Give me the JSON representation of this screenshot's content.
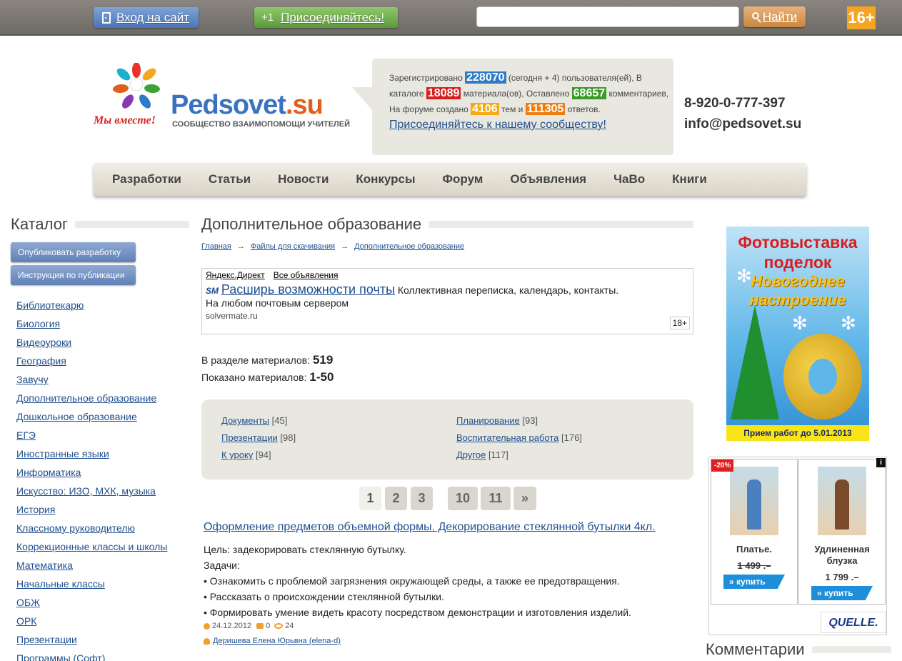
{
  "topbar": {
    "login_label": "Вход на сайт",
    "join_plus": "+1",
    "join_label": "Присоединяйтесь!",
    "search_value": "",
    "find_label": "Найти",
    "age_badge": "16+"
  },
  "logo": {
    "slogan": "Мы вместе!",
    "brand_main": "Pedsovet",
    "brand_tld": ".su",
    "subtitle": "СООБЩЕСТВО ВЗАИМОПОМОЩИ УЧИТЕЛЕЙ"
  },
  "stats": {
    "t1": "Зарегистрировано ",
    "users": "228070",
    "t2": " (сегодня + 4) пользователя(ей), В каталоге ",
    "materials": "18089",
    "t3": " материала(ов), Оставлено ",
    "comments": "68657",
    "t4": " комментариев, На форуме создано ",
    "topics": "4106",
    "t5": " тем и ",
    "answers": "111305",
    "t6": " ответов.",
    "join_link": "Присоединяйтесь к нашему сообществу!"
  },
  "contacts": {
    "phone": "8-920-0-777-397",
    "email": "info@pedsovet.su"
  },
  "nav": [
    {
      "label": "Разработки"
    },
    {
      "label": "Статьи"
    },
    {
      "label": "Новости"
    },
    {
      "label": "Конкурсы"
    },
    {
      "label": "Форум"
    },
    {
      "label": "Объявления"
    },
    {
      "label": "ЧаВо"
    },
    {
      "label": "Книги"
    }
  ],
  "sidebar": {
    "title": "Каталог",
    "publish_btn": "Опубликовать разработку",
    "instruction_btn": "Инструкция по публикации",
    "categories": [
      "Библиотекарю",
      "Биология",
      "Видеоуроки",
      "География",
      "Завучу",
      "Дополнительное образование",
      "Дошкольное образование",
      "ЕГЭ",
      "Иностранные языки",
      "Информатика",
      "Искусство: ИЗО, МХК, музыка",
      "История",
      "Классному руководителю",
      "Коррекционные классы и школы",
      "Математика",
      "Начальные классы",
      "ОБЖ",
      "ОРК",
      "Презентации",
      "Программы (Софт)"
    ]
  },
  "main": {
    "title": "Дополнительное образование",
    "breadcrumbs": [
      "Главная",
      "Файлы для скачивания",
      "Дополнительное образование"
    ],
    "crumb_arrow": "→",
    "ad": {
      "yandex": "Яндекс.Директ",
      "all_ads": "Все объявления",
      "logo": "SM",
      "link": "Расширь возможности почты",
      "text": " Коллективная переписка, календарь, контакты.",
      "text2": "На любом почтовым сервером",
      "domain": "solvermate.ru",
      "age": "18+"
    },
    "count_label": "В разделе материалов: ",
    "count_value": "519",
    "shown_label": "Показано материалов: ",
    "shown_value": "1-50",
    "tags": [
      {
        "label": "Документы",
        "count": "[45]"
      },
      {
        "label": "Презентации",
        "count": "[98]"
      },
      {
        "label": "К уроку",
        "count": "[94]"
      },
      {
        "label": "Планирование",
        "count": "[93]"
      },
      {
        "label": "Воспитательная работа",
        "count": "[176]"
      },
      {
        "label": "Другое",
        "count": "[117]"
      }
    ],
    "pages": [
      "1",
      "2",
      "3",
      "10",
      "11",
      "»"
    ],
    "article": {
      "title": "Оформление предметов объемной формы. Декорирование стеклянной бутылки 4кл.",
      "lines": [
        "Цель: задекорировать стеклянную бутылку.",
        "Задачи:",
        "• Ознакомить с проблемой загрязнения окружающей среды, а также ее предотвращения.",
        "• Рассказать о происхождении стеклянной бутылки.",
        "• Формировать умение видеть красоту посредством демонстрации и изготовления изделий."
      ],
      "date": "24.12.2012",
      "comments": "0",
      "views": "24",
      "author": "Деришева Елена Юрьвна (elena-d)"
    }
  },
  "banner": {
    "title": "Фотовыставка поделок",
    "subtitle": "Новогоднее настроение",
    "footer": "Прием работ до 5.01.2013"
  },
  "shop": {
    "sale": "-20%",
    "info": "i",
    "p1_name": "Платье.",
    "p1_price": "1 499 .–",
    "p2_name": "Удлиненная блузка",
    "p2_price": "1 799 .–",
    "buy": "» купить",
    "brand": "QUELLE."
  },
  "comments_title": "Комментарии"
}
